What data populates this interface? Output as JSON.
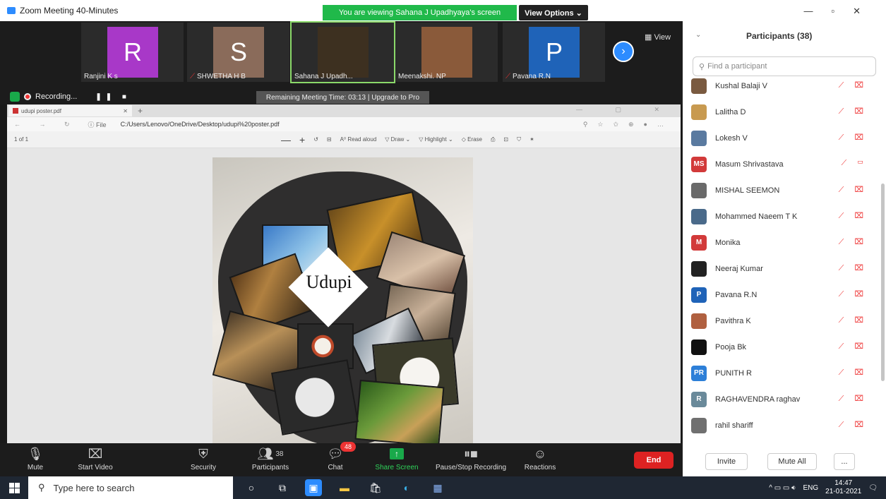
{
  "window": {
    "title": "Zoom Meeting 40-Minutes"
  },
  "banner": {
    "viewing": "You are viewing Sahana J Upadhyaya's screen",
    "view_options": "View Options ⌄"
  },
  "strip": {
    "view_label": "▦ View",
    "tiles": [
      {
        "name": "Ranjini K s",
        "initial": "R",
        "color": "#a838c8",
        "muted": false
      },
      {
        "name": "SHWETHA H B",
        "initial": "S",
        "color": "#8a6b5a",
        "muted": true
      },
      {
        "name": "Sahana J Upadh...",
        "initial": "",
        "color": "#3d3020",
        "muted": false
      },
      {
        "name": "Meenakshi. NP",
        "initial": "",
        "color": "#8a5a3a",
        "muted": false
      },
      {
        "name": "Pavana R.N",
        "initial": "P",
        "color": "#1f63b8",
        "muted": true
      }
    ]
  },
  "recording": {
    "label": "Recording...",
    "controls": "❚❚ ■"
  },
  "remaining": "Remaining Meeting Time: 03:13 | Upgrade to Pro",
  "browser": {
    "tab_title": "udupi poster.pdf",
    "url_prefix": "ⓘ File",
    "url": "C:/Users/Lenovo/OneDrive/Desktop/udupi%20poster.pdf",
    "page_num": "1",
    "page_of": "of 1",
    "tools": [
      "—",
      "+",
      "↺",
      "⊟",
      "A⁰ Read aloud",
      "▽ Draw ⌄",
      "▽ Highlight ⌄",
      "◇ Erase",
      "⎙",
      "⊡",
      "⛉",
      "✶"
    ]
  },
  "poster": {
    "label": "Udupi"
  },
  "toolbar": {
    "mute": "Mute",
    "start_video": "Start Video",
    "security": "Security",
    "participants": "Participants",
    "participants_count": "38",
    "chat": "Chat",
    "chat_badge": "48",
    "share_screen": "Share Screen",
    "pause_stop": "Pause/Stop Recording",
    "reactions": "Reactions",
    "end": "End"
  },
  "panel": {
    "title": "Participants (38)",
    "search_placeholder": "Find a participant",
    "invite": "Invite",
    "mute_all": "Mute All",
    "more": "...",
    "participants": [
      {
        "name": "Kushal Balaji V",
        "initials": "",
        "color": "#7a5a40",
        "video": "off"
      },
      {
        "name": "Lalitha D",
        "initials": "",
        "color": "#c89a50",
        "video": "off"
      },
      {
        "name": "Lokesh V",
        "initials": "",
        "color": "#5a7aa0",
        "video": "off"
      },
      {
        "name": "Masum Shrivastava",
        "initials": "MS",
        "color": "#d23a3a",
        "video": "on"
      },
      {
        "name": "MISHAL SEEMON",
        "initials": "",
        "color": "#6a6a6a",
        "video": "off"
      },
      {
        "name": "Mohammed Naeem T K",
        "initials": "",
        "color": "#4a6a8a",
        "video": "off"
      },
      {
        "name": "Monika",
        "initials": "M",
        "color": "#d23a3a",
        "video": "off"
      },
      {
        "name": "Neeraj Kumar",
        "initials": "",
        "color": "#222222",
        "video": "off"
      },
      {
        "name": "Pavana R.N",
        "initials": "P",
        "color": "#1f63b8",
        "video": "off"
      },
      {
        "name": "Pavithra K",
        "initials": "",
        "color": "#b06040",
        "video": "off"
      },
      {
        "name": "Pooja Bk",
        "initials": "",
        "color": "#111111",
        "video": "off"
      },
      {
        "name": "PUNITH R",
        "initials": "PR",
        "color": "#2d7fd8",
        "video": "off"
      },
      {
        "name": "RAGHAVENDRA raghav",
        "initials": "R",
        "color": "#6a8a9a",
        "video": "off"
      },
      {
        "name": "rahil shariff",
        "initials": "",
        "color": "#707070",
        "video": "off"
      }
    ]
  },
  "taskbar": {
    "search_placeholder": "Type here to search",
    "lang": "ENG",
    "time": "14:47",
    "date": "21-01-2021"
  }
}
